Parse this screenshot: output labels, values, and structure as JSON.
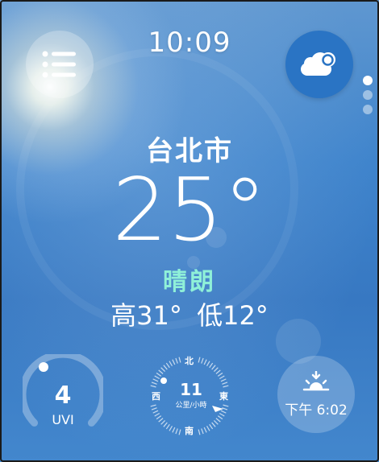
{
  "status": {
    "time": "10:09"
  },
  "location": {
    "city": "台北市"
  },
  "current": {
    "temperature": "25°",
    "condition": "晴朗",
    "high_label": "高31°",
    "low_label": "低12°"
  },
  "uv": {
    "value": "4",
    "label": "UVI",
    "arc_fraction": 0.36
  },
  "wind": {
    "speed": "11",
    "unit": "公里/小時",
    "directions": {
      "n": "北",
      "s": "南",
      "e": "東",
      "w": "西"
    }
  },
  "sunset": {
    "time": "下午 6:02"
  },
  "pager": {
    "count": 3,
    "active": 0
  },
  "icons": {
    "menu": "menu-list-icon",
    "weather": "cloud-icon",
    "sunset": "sunset-icon",
    "wind": "wind-arrow-icon"
  },
  "colors": {
    "condition": "#8ff0d8",
    "cloud_button": "#2a74c4"
  }
}
